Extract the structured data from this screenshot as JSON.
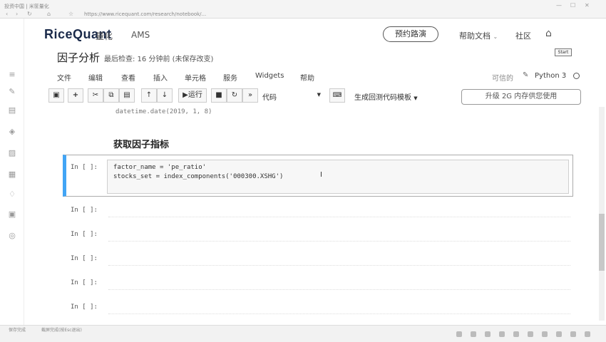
{
  "browser": {
    "tab_title": "投资中国 | 米筐量化",
    "url": "https://www.ricequant.com/research/notebook/...",
    "url_domain": "www.ricequant.com"
  },
  "header": {
    "logo": "RiceQuant",
    "nav": [
      "量化",
      "AMS"
    ],
    "roadshow_button": "预约路演",
    "help_docs": "帮助文档",
    "community": "社区",
    "start_label": "Start"
  },
  "notebook": {
    "title": "因子分析",
    "checkpoint": "最后检查: 16 分钟前  (未保存改变)",
    "menu": [
      "文件",
      "编辑",
      "查看",
      "插入",
      "单元格",
      "服务",
      "Widgets",
      "帮助"
    ],
    "trusted": "可信的",
    "kernel": "Python 3",
    "toolbar": {
      "run_label": "运行",
      "cell_type": "代码",
      "gen_code_label": "生成回测代码模板",
      "upgrade_label": "升级 2G 内存供您使用"
    },
    "prev_output": "datetime.date(2019, 1, 8)",
    "markdown_heading": "获取因子指标",
    "active_cell": {
      "prompt": "In [ ]:",
      "line1": "factor_name = 'pe_ratio'",
      "line2": "stocks_set = index_components('000300.XSHG')"
    },
    "empty_cells": [
      {
        "prompt": "In [ ]:"
      },
      {
        "prompt": "In [ ]:"
      },
      {
        "prompt": "In [ ]:"
      },
      {
        "prompt": "In [ ]:"
      },
      {
        "prompt": "In [ ]:"
      }
    ]
  },
  "taskbar": {
    "status_left": "保存完成",
    "status_mid": "截屏完成(按Esc退出)"
  },
  "colors": {
    "active_cell_border": "#42a5f5",
    "logo": "#1a2a4a"
  }
}
